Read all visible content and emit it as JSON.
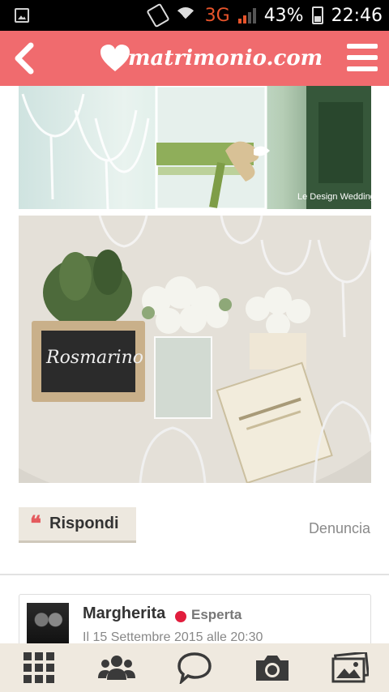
{
  "status_bar": {
    "network": "3G",
    "battery": "43%",
    "time": "22:46"
  },
  "header": {
    "logo_text": "matrimonio.com",
    "colors": {
      "brand": "#f06b6e"
    }
  },
  "photos": [
    {
      "watermark": "Le Design Wedding"
    },
    {
      "chalkboard_text": "Rosmarino"
    }
  ],
  "actions": {
    "reply_label": "Rispondi",
    "report_label": "Denuncia"
  },
  "comment": {
    "author": "Margherita",
    "badge": "Esperta",
    "date": "Il 15 Settembre 2015 alle 20:30",
    "status_color": "#e11d3d"
  },
  "bottom_nav": {
    "items": [
      "grid-icon",
      "community-icon",
      "chat-icon",
      "camera-icon",
      "photos-icon"
    ]
  }
}
